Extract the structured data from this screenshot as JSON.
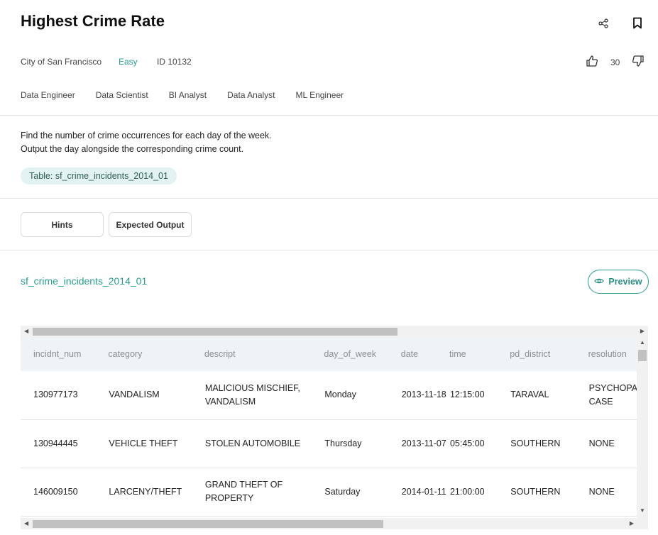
{
  "header": {
    "title": "Highest Crime Rate",
    "company": "City of San Francisco",
    "difficulty": "Easy",
    "id_label": "ID 10132",
    "likes": "30"
  },
  "roles": [
    "Data Engineer",
    "Data Scientist",
    "BI Analyst",
    "Data Analyst",
    "ML Engineer"
  ],
  "description": {
    "line1": "Find the number of crime occurrences for each day of the week.",
    "line2": "Output the day alongside the corresponding crime count."
  },
  "table_pill": "Table: sf_crime_incidents_2014_01",
  "buttons": {
    "hints": "Hints",
    "expected_output": "Expected Output",
    "preview": "Preview"
  },
  "dataset": {
    "name": "sf_crime_incidents_2014_01",
    "columns": [
      "incidnt_num",
      "category",
      "descript",
      "day_of_week",
      "date",
      "time",
      "pd_district",
      "resolution"
    ],
    "rows": [
      [
        "130977173",
        "VANDALISM",
        "MALICIOUS MISCHIEF, VANDALISM",
        "Monday",
        "2013-11-18",
        "12:15:00",
        "TARAVAL",
        "PSYCHOPATHIC CASE"
      ],
      [
        "130944445",
        "VEHICLE THEFT",
        "STOLEN AUTOMOBILE",
        "Thursday",
        "2013-11-07",
        "05:45:00",
        "SOUTHERN",
        "NONE"
      ],
      [
        "146009150",
        "LARCENY/THEFT",
        "GRAND THEFT OF PROPERTY",
        "Saturday",
        "2014-01-11",
        "21:00:00",
        "SOUTHERN",
        "NONE"
      ]
    ]
  },
  "colors": {
    "accent": "#2a9d8f",
    "pill_bg": "#e3f3f1",
    "header_bg": "#f0f3f5"
  }
}
